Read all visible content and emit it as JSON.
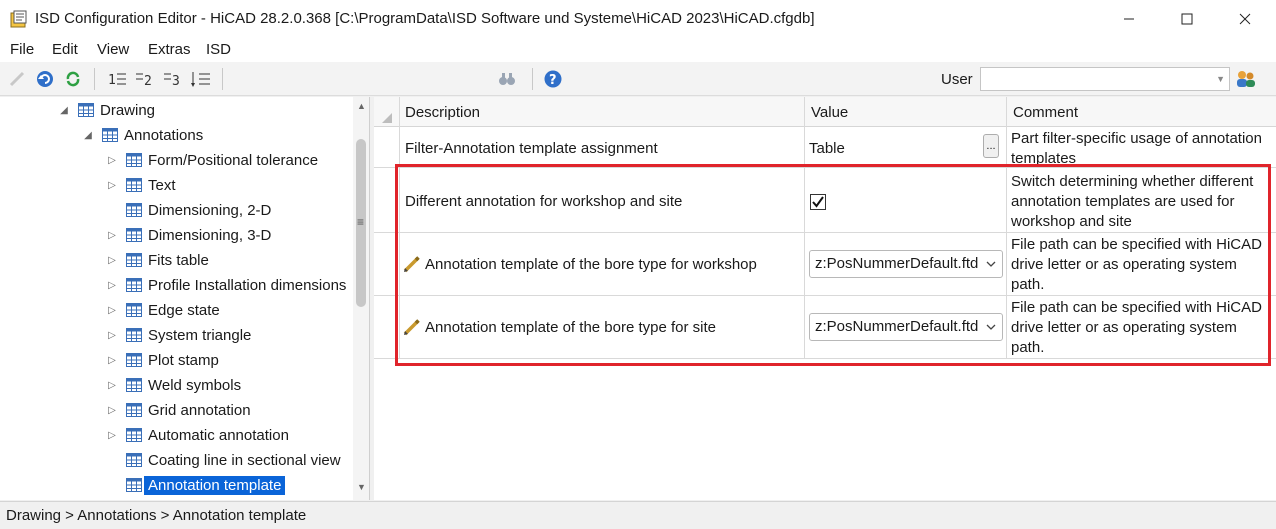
{
  "window": {
    "title": "ISD Configuration Editor  - HiCAD 28.2.0.368 [C:\\ProgramData\\ISD Software und Systeme\\HiCAD 2023\\HiCAD.cfgdb]"
  },
  "menu": [
    "File",
    "Edit",
    "View",
    "Extras",
    "ISD"
  ],
  "toolbar": {
    "user_label": "User",
    "user_value": ""
  },
  "tree": {
    "items": [
      {
        "label": "Drawing",
        "expander": "expanded"
      },
      {
        "label": "Annotations",
        "expander": "expanded"
      },
      {
        "label": "Form/Positional tolerance",
        "expander": "collapsed"
      },
      {
        "label": "Text",
        "expander": "collapsed"
      },
      {
        "label": "Dimensioning, 2-D",
        "expander": "none"
      },
      {
        "label": "Dimensioning, 3-D",
        "expander": "collapsed"
      },
      {
        "label": "Fits table",
        "expander": "collapsed"
      },
      {
        "label": "Profile Installation dimensions",
        "expander": "collapsed"
      },
      {
        "label": "Edge state",
        "expander": "collapsed"
      },
      {
        "label": "System triangle",
        "expander": "collapsed"
      },
      {
        "label": "Plot stamp",
        "expander": "collapsed"
      },
      {
        "label": "Weld symbols",
        "expander": "collapsed"
      },
      {
        "label": "Grid annotation",
        "expander": "collapsed"
      },
      {
        "label": "Automatic annotation",
        "expander": "collapsed"
      },
      {
        "label": "Coating line in sectional view",
        "expander": "none"
      },
      {
        "label": "Annotation template",
        "expander": "none",
        "selected": true
      }
    ]
  },
  "grid": {
    "columns": {
      "description": "Description",
      "value": "Value",
      "comment": "Comment"
    },
    "rows": [
      {
        "description": "Filter-Annotation template assignment",
        "value": "Table",
        "button": "...",
        "comment": "Part filter-specific usage of annotation templates"
      },
      {
        "description": "Different annotation for workshop and site",
        "checked": true,
        "comment": "Switch determining whether different annotation templates are used for workshop and site"
      },
      {
        "description": "Annotation template of the bore type for workshop",
        "value": "z:PosNummerDefault.ftd",
        "comment": "File path can be specified with HiCAD drive letter or as operating system path."
      },
      {
        "description": "Annotation template of the bore type for site",
        "value": "z:PosNummerDefault.ftd",
        "comment": "File path can be specified with HiCAD drive letter or as operating system path."
      }
    ]
  },
  "status": {
    "breadcrumb": "Drawing > Annotations > Annotation template"
  },
  "colors": {
    "selection": "#0a64d8",
    "highlight_frame": "#e0242b"
  }
}
